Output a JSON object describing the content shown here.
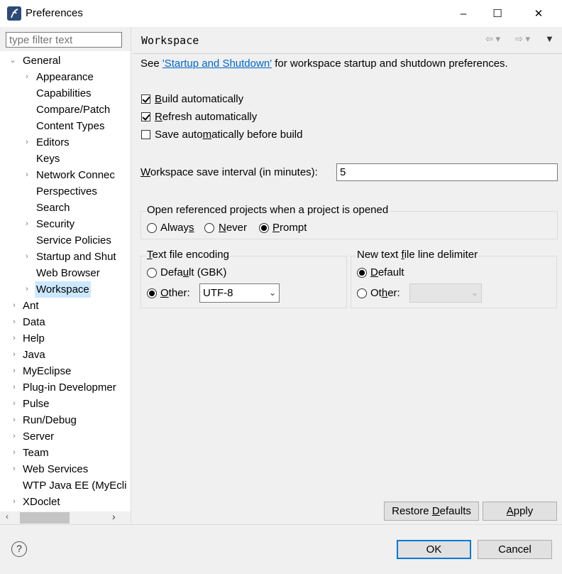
{
  "window": {
    "title": "Preferences",
    "minimize": "–",
    "maximize": "☐",
    "close": "✕"
  },
  "filter": {
    "placeholder": "type filter text"
  },
  "tree": {
    "general": "General",
    "general_children": [
      "Appearance",
      "Capabilities",
      "Compare/Patch",
      "Content Types",
      "Editors",
      "Keys",
      "Network Connec",
      "Perspectives",
      "Search",
      "Security",
      "Service Policies",
      "Startup and Shut",
      "Web Browser",
      "Workspace"
    ],
    "top_items": [
      "Ant",
      "Data",
      "Help",
      "Java",
      "MyEclipse",
      "Plug-in Developmer",
      "Pulse",
      "Run/Debug",
      "Server",
      "Team",
      "Web Services",
      "WTP Java EE (MyEcli",
      "XDoclet"
    ]
  },
  "page": {
    "title": "Workspace",
    "see_prefix": "See ",
    "see_link": "'Startup and Shutdown'",
    "see_suffix": " for workspace startup and shutdown preferences.",
    "build_auto": {
      "pre": "",
      "ul": "B",
      "post": "uild automatically",
      "checked": true
    },
    "refresh_auto": {
      "pre": "",
      "ul": "R",
      "post": "efresh automatically",
      "checked": true
    },
    "save_auto": {
      "pre": "Save auto",
      "ul": "m",
      "post": "atically before build",
      "checked": false
    },
    "interval_label_ul": "W",
    "interval_label_rest": "orkspace save interval (in minutes):",
    "interval_value": "5",
    "open_group": {
      "label": "Open referenced projects when a project is opened",
      "always_pre": "Alway",
      "always_ul": "s",
      "always_post": "",
      "never_ul": "N",
      "never_post": "ever",
      "prompt_ul": "P",
      "prompt_post": "rompt",
      "selected": "Prompt"
    },
    "encoding_group": {
      "label_ul": "T",
      "label_rest": "ext file encoding",
      "default_pre": "Defa",
      "default_ul": "u",
      "default_post": "lt (GBK)",
      "other_ul": "O",
      "other_post": "ther:",
      "other_value": "UTF-8",
      "selected": "Other"
    },
    "delimiter_group": {
      "label_pre": "New text ",
      "label_ul": "f",
      "label_post": "ile line delimiter",
      "default_ul": "D",
      "default_post": "efault",
      "other_pre": "Ot",
      "other_ul": "h",
      "other_post": "er:",
      "other_value": "",
      "selected": "Default"
    },
    "restore_pre": "Restore ",
    "restore_ul": "D",
    "restore_post": "efaults",
    "apply_ul": "A",
    "apply_post": "pply"
  },
  "footer": {
    "ok": "OK",
    "cancel": "Cancel",
    "help": "?"
  },
  "colors": {
    "selection": "#cce8ff",
    "link": "#0066cc",
    "default_button_border": "#0078d7"
  }
}
